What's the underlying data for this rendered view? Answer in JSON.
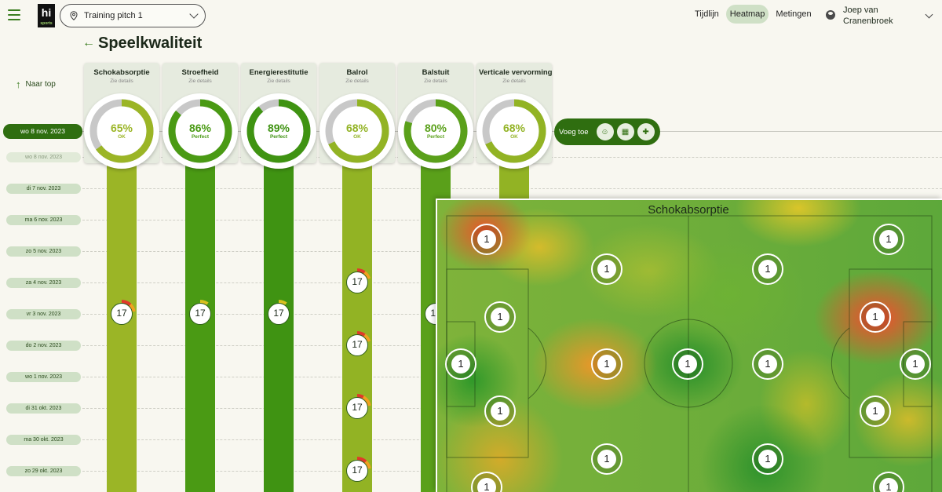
{
  "header": {
    "logo_text": "hi",
    "logo_sub": "sports",
    "pitch_select": "Training pitch 1",
    "nav": {
      "tijdlijn": "Tijdlijn",
      "heatmap": "Heatmap",
      "metingen": "Metingen"
    },
    "user_name": "Joep van Cranenbroek"
  },
  "page": {
    "title": "Speelkwaliteit",
    "naar_top": "Naar top"
  },
  "dates": {
    "active": "wo 8 nov. 2023",
    "faded": "wo 8 nov. 2023",
    "d1": "di 7 nov. 2023",
    "d2": "ma 6 nov. 2023",
    "d3": "zo 5 nov. 2023",
    "d4": "za 4 nov. 2023",
    "d5": "vr 3 nov. 2023",
    "d6": "do 2 nov. 2023",
    "d7": "wo 1 nov. 2023",
    "d8": "di 31 okt. 2023",
    "d9": "ma 30 okt. 2023",
    "d10": "zo 29 okt. 2023"
  },
  "metrics": {
    "m1": {
      "title": "Schokabsorptie",
      "sub": "Zie details",
      "pct": "65%",
      "label": "OK",
      "value": 65,
      "color": "#9bb526"
    },
    "m2": {
      "title": "Stroefheid",
      "sub": "Zie details",
      "pct": "86%",
      "label": "Perfect",
      "value": 86,
      "color": "#4a9a14"
    },
    "m3": {
      "title": "Energierestitutie",
      "sub": "Zie details",
      "pct": "89%",
      "label": "Perfect",
      "value": 89,
      "color": "#3f9312"
    },
    "m4": {
      "title": "Balrol",
      "sub": "Zie details",
      "pct": "68%",
      "label": "OK",
      "value": 68,
      "color": "#92b324"
    },
    "m5": {
      "title": "Balstuit",
      "sub": "Zie details",
      "pct": "80%",
      "label": "Perfect",
      "value": 80,
      "color": "#5aa01a"
    },
    "m6": {
      "title": "Verticale vervorming",
      "sub": "Zie details",
      "pct": "68%",
      "label": "OK",
      "value": 68,
      "color": "#92b324"
    }
  },
  "marker_label": "17",
  "toolbar": {
    "voeg_toe": "Voeg toe",
    "icon1": "smiley-add-icon",
    "icon2": "calendar-icon",
    "icon3": "note-add-icon"
  },
  "heatmap": {
    "title": "Schokabsorptie",
    "marker_value": "1"
  }
}
